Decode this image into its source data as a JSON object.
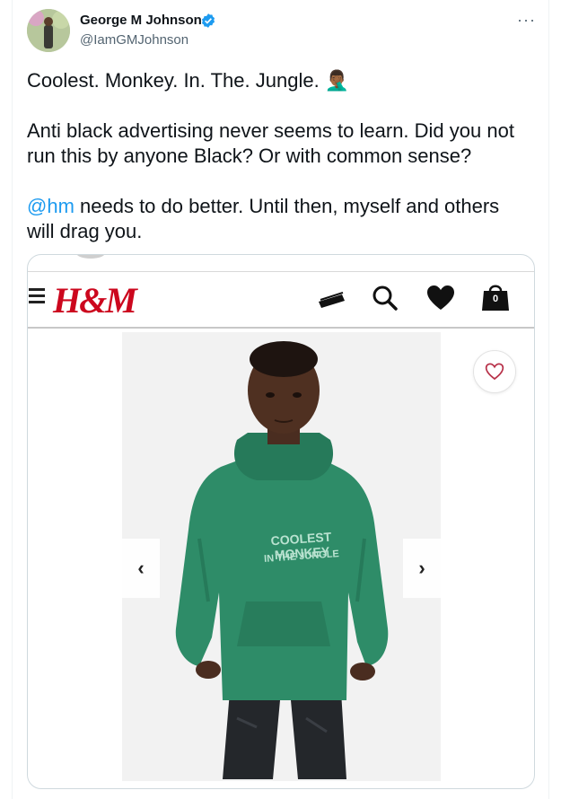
{
  "tweet": {
    "author_name": "George M Johnson",
    "author_handle": "@IamGMJohnson",
    "more_glyph": "···",
    "line1": "Coolest. Monkey. In. The. Jungle. 🤦🏾‍♂️",
    "line2": "Anti black advertising never seems to learn. Did you not run this by anyone Black? Or with common sense?",
    "mention": "@hm",
    "line3_rest": " needs to do better. Until then, myself and others will drag you."
  },
  "media": {
    "logo": "H&M",
    "bag_count": "0",
    "hoodie_line1": "COOLEST MONKEY",
    "hoodie_line2": "IN THE JUNGLE",
    "prev_arrow": "‹",
    "next_arrow": "›"
  },
  "colors": {
    "accent": "#1d9bf0",
    "hm_red": "#cc071e",
    "hoodie": "#2e8c68"
  }
}
